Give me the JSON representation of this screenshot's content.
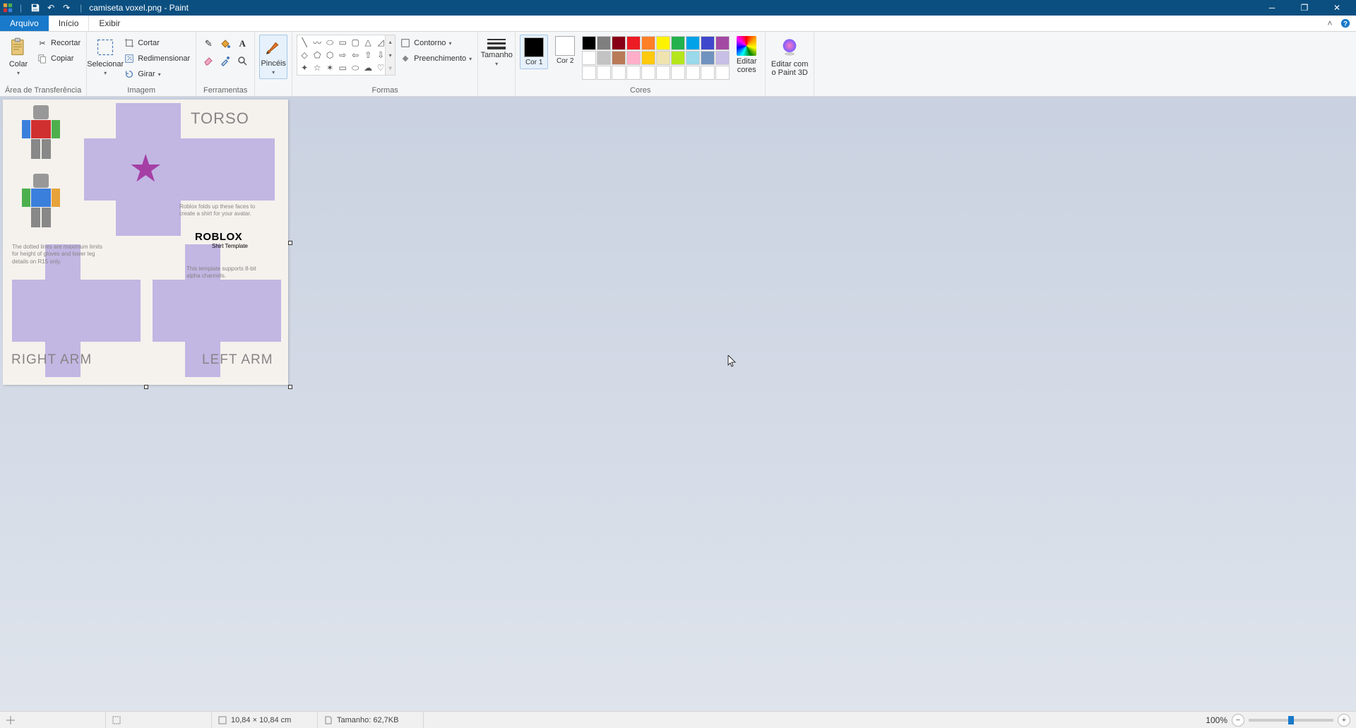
{
  "titlebar": {
    "filename": "camiseta voxel.png",
    "app": "Paint",
    "title_sep": " - "
  },
  "tabs": {
    "file": "Arquivo",
    "home": "Início",
    "view": "Exibir"
  },
  "ribbon": {
    "clipboard": {
      "paste": "Colar",
      "cut": "Recortar",
      "copy": "Copiar",
      "group": "Área de Transferência"
    },
    "image": {
      "select": "Selecionar",
      "crop": "Cortar",
      "resize": "Redimensionar",
      "rotate": "Girar",
      "group": "Imagem"
    },
    "tools": {
      "group": "Ferramentas",
      "brushes": "Pincéis"
    },
    "shapes": {
      "outline": "Contorno",
      "fill": "Preenchimento",
      "thickness": "Tamanho",
      "group": "Formas",
      "glyphs": [
        "╲",
        "〰",
        "⬭",
        "▭",
        "▢",
        "△",
        "◇",
        "◯",
        "⬠",
        "⬡",
        "→",
        "←",
        "↑",
        "★",
        "☆",
        "✦",
        "⬨",
        "⌂",
        "☁",
        "💬",
        "💭"
      ]
    },
    "colors": {
      "color1": "Cor 1",
      "color2": "Cor 2",
      "edit": "Editar cores",
      "group": "Cores",
      "color1_value": "#000000",
      "color2_value": "#ffffff",
      "row1": [
        "#000000",
        "#7f7f7f",
        "#880015",
        "#ed1c24",
        "#ff7f27",
        "#fff200",
        "#22b14c",
        "#00a2e8",
        "#3f48cc",
        "#a349a4"
      ],
      "row2": [
        "#ffffff",
        "#c3c3c3",
        "#b97a57",
        "#ffaec9",
        "#ffc90e",
        "#efe4b0",
        "#b5e61d",
        "#99d9ea",
        "#7092be",
        "#c8bfe7"
      ],
      "row3": [
        "#ffffff",
        "#ffffff",
        "#ffffff",
        "#ffffff",
        "#ffffff",
        "#ffffff",
        "#ffffff",
        "#ffffff",
        "#ffffff",
        "#ffffff"
      ]
    },
    "paint3d": "Editar com o Paint 3D"
  },
  "canvas": {
    "torso": "TORSO",
    "right_arm": "RIGHT ARM",
    "left_arm": "LEFT ARM",
    "fold_note": "Roblox folds up these faces to create a shirt for your avatar.",
    "dotted_note": "The dotted lines are maximum limits for height of gloves and lower leg details on R15 only.",
    "alpha_note": "This template supports 8-bit alpha channels.",
    "brand": "ROBLOX",
    "brand_sub": "Shirt Template"
  },
  "statusbar": {
    "dims_label": "10,84 × 10,84 cm",
    "size_label": "Tamanho: 62,7KB",
    "zoom": "100%"
  }
}
